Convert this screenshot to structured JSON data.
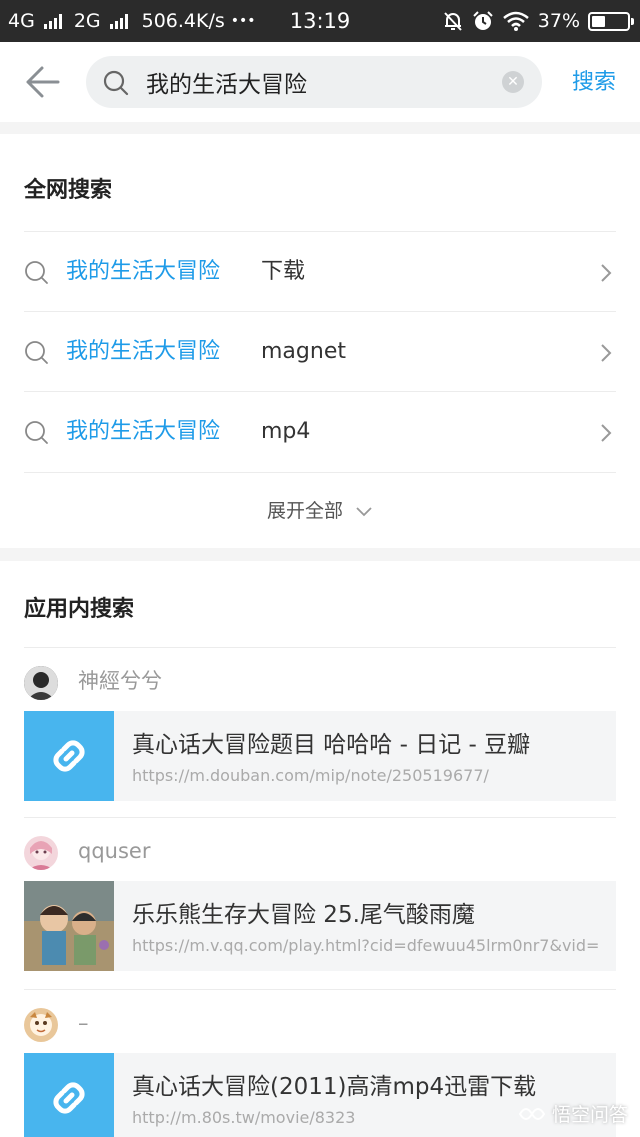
{
  "status_bar": {
    "network1": "4G",
    "network2": "2G",
    "speed": "506.4K/s",
    "more": "•••",
    "time": "13:19",
    "battery": "37%",
    "battery_level": 0.37
  },
  "search": {
    "query": "我的生活大冒险",
    "button_label": "搜索"
  },
  "web_search": {
    "title": "全网搜索",
    "items": [
      {
        "keyword": "我的生活大冒险",
        "suffix": "下载"
      },
      {
        "keyword": "我的生活大冒险",
        "suffix": "magnet"
      },
      {
        "keyword": "我的生活大冒险",
        "suffix": "mp4"
      }
    ],
    "expand_label": "展开全部"
  },
  "app_search": {
    "title": "应用内搜索",
    "results": [
      {
        "user": "神經兮兮",
        "title": "真心话大冒险题目 哈哈哈 - 日记 - 豆瓣",
        "url": "https://m.douban.com/mip/note/250519677/",
        "thumb": "link"
      },
      {
        "user": "qquser",
        "title": "乐乐熊生存大冒险 25.尾气酸雨魔",
        "url": "https://m.v.qq.com/play.html?cid=dfewuu45lrm0nr7&vid=",
        "thumb": "image"
      },
      {
        "user": "–",
        "title": "真心话大冒险(2011)高清mp4迅雷下载",
        "url": "http://m.80s.tw/movie/8323",
        "thumb": "link"
      }
    ]
  },
  "watermark": "悟空问答",
  "colors": {
    "accent": "#1e9be8",
    "link_thumb": "#48b5ee",
    "status_bar": "#2b2b2b"
  }
}
